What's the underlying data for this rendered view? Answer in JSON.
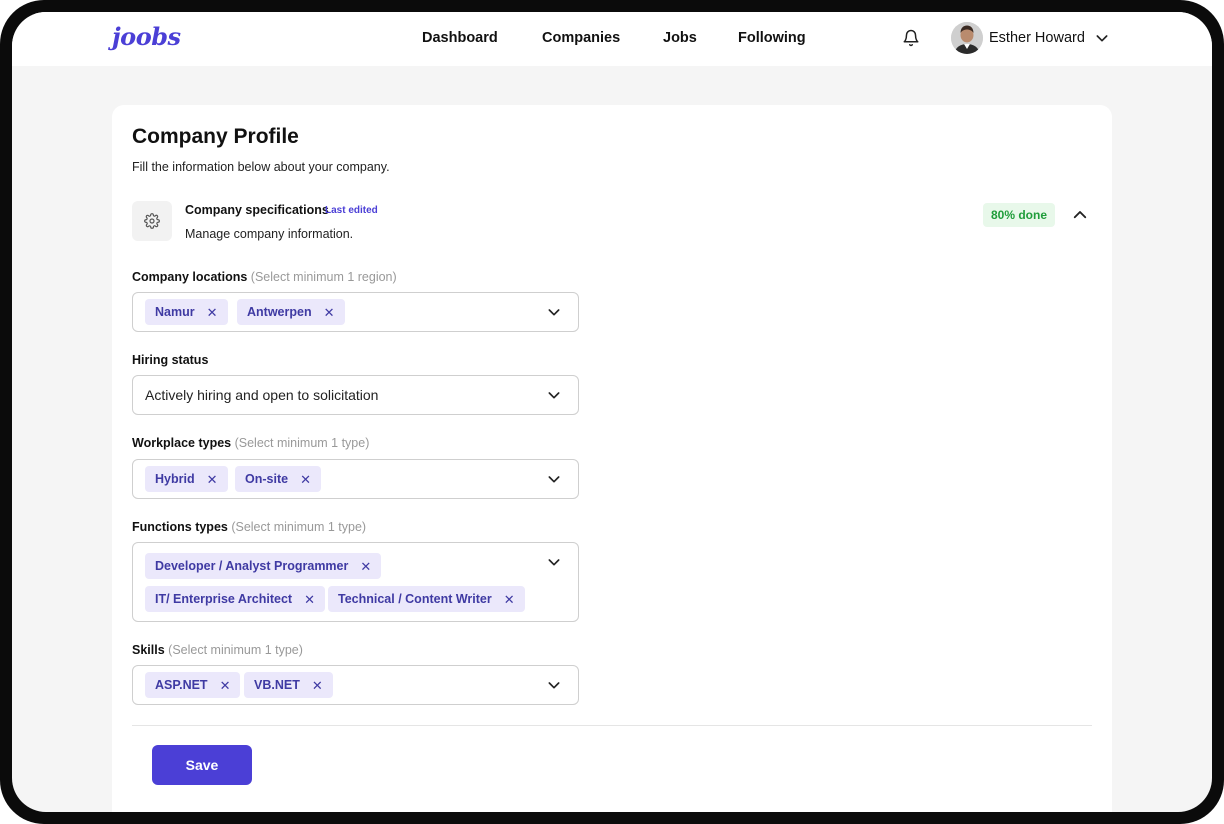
{
  "brand": {
    "logo_text": "joobs",
    "accent_color": "#4b3fd6"
  },
  "nav": {
    "items": [
      {
        "label": "Dashboard"
      },
      {
        "label": "Companies"
      },
      {
        "label": "Jobs"
      },
      {
        "label": "Following"
      }
    ]
  },
  "header": {
    "notification_icon": "bell-icon",
    "user_name": "Esther Howard",
    "user_menu_icon": "chevron-down-icon"
  },
  "page": {
    "title": "Company Profile",
    "subtitle": "Fill the information below about your company."
  },
  "section": {
    "icon": "gear-icon",
    "title": "Company specifications",
    "edited_label": "Last edited",
    "description": "Manage company information.",
    "progress_label": "80% done",
    "progress_percent": 80,
    "progress_color": "#1f9d3a",
    "collapse_icon": "chevron-up-icon"
  },
  "fields": {
    "locations": {
      "label": "Company locations",
      "hint": "(Select minimum 1 region)",
      "chips": [
        "Namur",
        "Antwerpen"
      ]
    },
    "hiring_status": {
      "label": "Hiring status",
      "value": "Actively hiring and open to solicitation"
    },
    "workplace": {
      "label": "Workplace types",
      "hint": "(Select minimum 1 type)",
      "chips": [
        "Hybrid",
        "On-site"
      ]
    },
    "functions": {
      "label": "Functions types",
      "hint": "(Select minimum 1 type)",
      "chips": [
        "Developer / Analyst Programmer",
        "IT/ Enterprise Architect",
        "Technical / Content Writer"
      ]
    },
    "skills": {
      "label": "Skills",
      "hint": "(Select minimum 1 type)",
      "chips": [
        "ASP.NET",
        "VB.NET"
      ]
    }
  },
  "chip_remove_glyph": "✕",
  "actions": {
    "save_label": "Save"
  }
}
